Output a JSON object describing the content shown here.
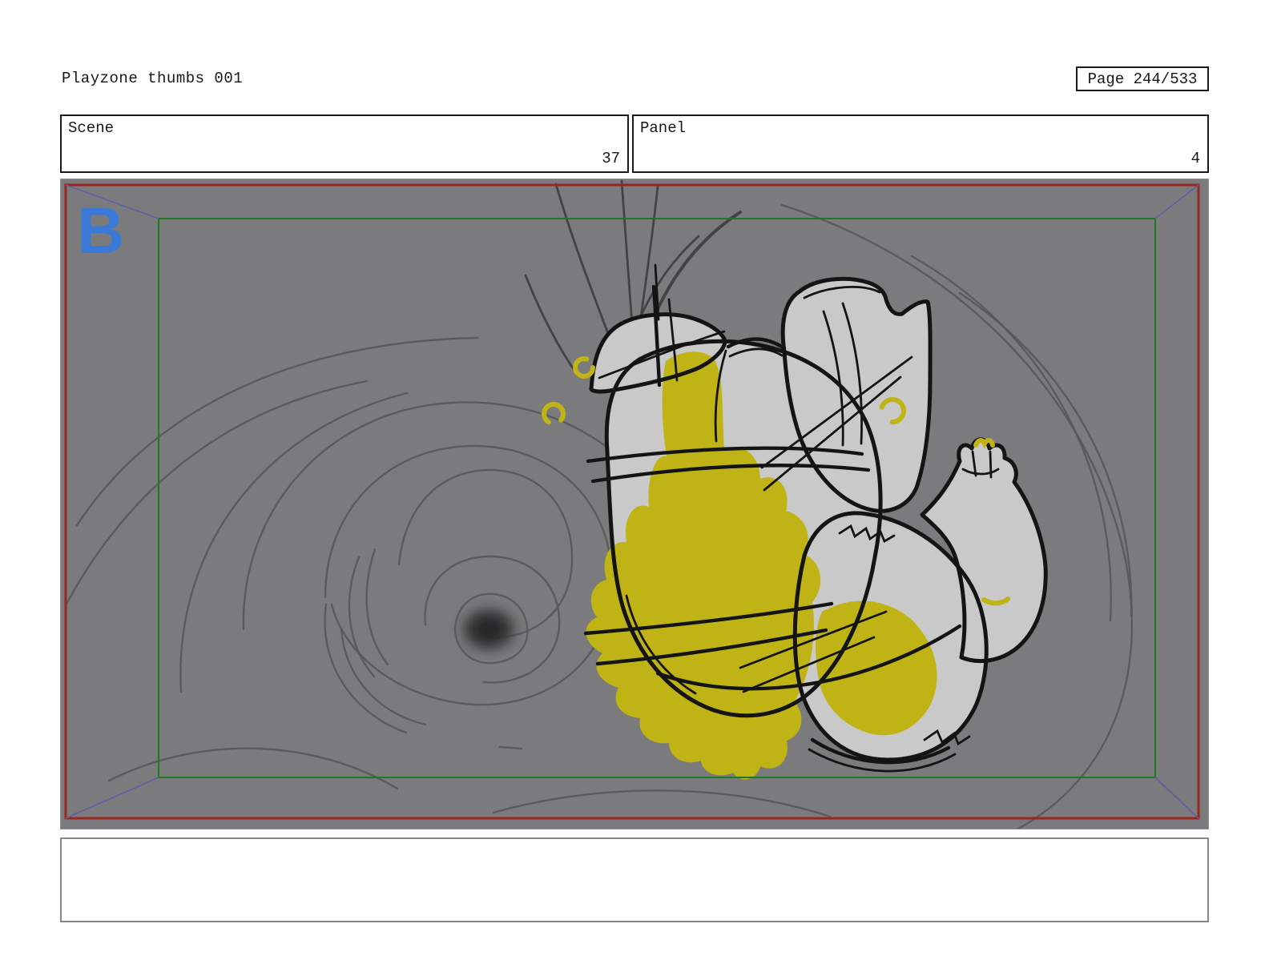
{
  "header": {
    "title": "Playzone thumbs 001",
    "page_label": "Page 244/533"
  },
  "fields": {
    "scene": {
      "label": "Scene",
      "value": "37"
    },
    "panel": {
      "label": "Panel",
      "value": "4"
    }
  },
  "canvas": {
    "marker_label": "B"
  },
  "notes": {
    "text": ""
  },
  "colors": {
    "canvas-bg": "#7b7b7d",
    "sketch": "#58585b",
    "sketch-dark": "#434345",
    "ink": "#141414",
    "fill-gray": "#c9c9c9",
    "splash": "#c0b315",
    "frame-red": "#99271f",
    "safe-green": "#1e7a1e",
    "wire-blue": "#5e5ea9",
    "marker-blue": "#3b79d8"
  }
}
